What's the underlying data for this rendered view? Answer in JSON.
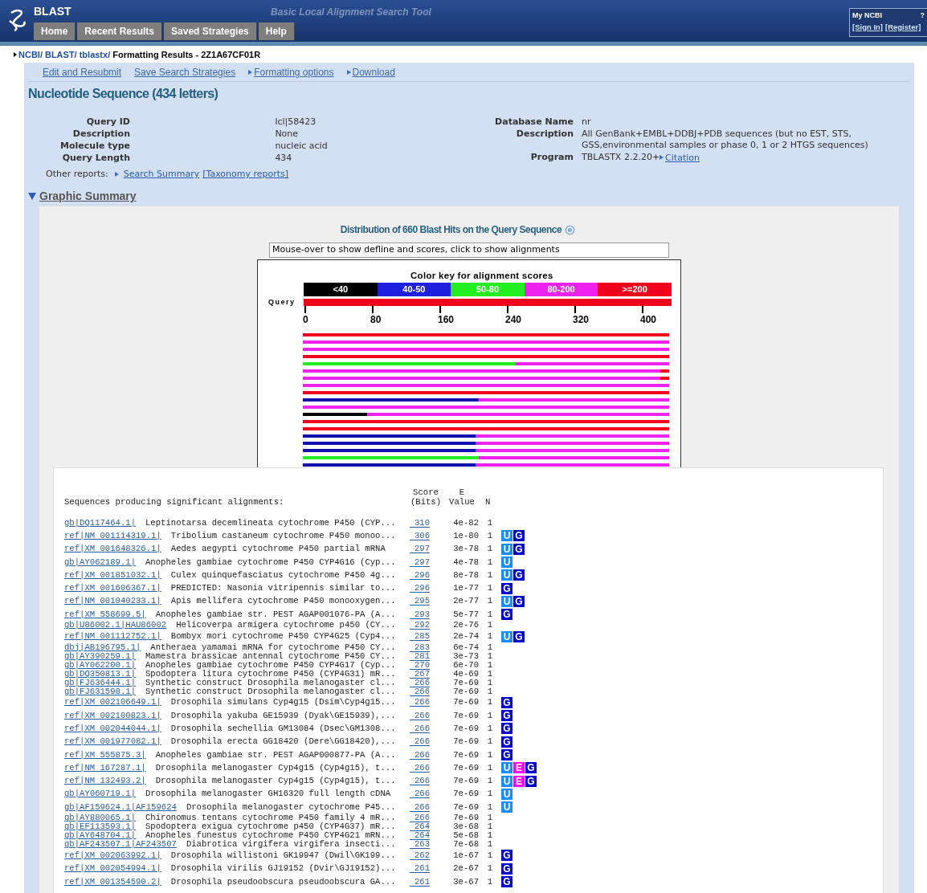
{
  "header": {
    "logo_text": "BLAST",
    "subtitle": "Basic Local Alignment Search Tool",
    "tabs": [
      {
        "label": "Home"
      },
      {
        "label": "Recent Results"
      },
      {
        "label": "Saved Strategies"
      },
      {
        "label": "Help"
      }
    ],
    "my_ncbi": {
      "title": "My NCBI",
      "help": "?",
      "links": [
        "[Sign In]",
        "[Register]"
      ]
    }
  },
  "breadcrumb": {
    "links": [
      "NCBI/",
      "BLAST/",
      "tblastx/"
    ],
    "current": "Formatting Results - 2Z1A67CF01R"
  },
  "toolbar": [
    {
      "label": "Edit and Resubmit",
      "kind": "plain"
    },
    {
      "label": "Save Search Strategies",
      "kind": "plain"
    },
    {
      "label": "Formatting options",
      "kind": "toggle"
    },
    {
      "label": "Download",
      "kind": "toggle"
    }
  ],
  "heading": "Nucleotide Sequence (434 letters)",
  "query_info": [
    {
      "label": "Query ID",
      "value": "lcl|58423"
    },
    {
      "label": "Description",
      "value": "None"
    },
    {
      "label": "Molecule type",
      "value": "nucleic acid"
    },
    {
      "label": "Query Length",
      "value": "434"
    }
  ],
  "database_info": [
    {
      "label": "Database Name",
      "value": "nr"
    },
    {
      "label": "Description",
      "value": "All GenBank+EMBL+DDBJ+PDB sequences (but no EST, STS, GSS,environmental samples or phase 0, 1 or 2 HTGS sequences)"
    },
    {
      "label": "Program",
      "value": "TBLASTX 2.2.20+",
      "link": "Citation"
    }
  ],
  "other_reports": {
    "label": "Other reports:",
    "links": [
      {
        "label": "Search Summary",
        "kind": "toggle"
      },
      {
        "label": "[Taxonomy reports]",
        "kind": "plain"
      }
    ]
  },
  "graphic_summary": {
    "title": "Graphic Summary",
    "expanded": true,
    "distribution_title": "Distribution of 660 Blast Hits on the Query Sequence",
    "info_field": {
      "value": "Mouse-over to show defline and scores, click to show alignments"
    },
    "color_key_title": "Color key for alignment scores",
    "color_key": [
      {
        "label": "<40",
        "color": "#000000"
      },
      {
        "label": "40-50",
        "color": "#1f1fe0"
      },
      {
        "label": "50-80",
        "color": "#22ee22"
      },
      {
        "label": "80-200",
        "color": "#ee22ee"
      },
      {
        "label": ">=200",
        "color": "#f0001c"
      }
    ],
    "query_label": "Query",
    "axis_ticks": [
      "0",
      "80",
      "160",
      "240",
      "320",
      "400"
    ]
  },
  "alignments": {
    "title": "Sequences producing significant alignments:",
    "columns": {
      "score": [
        "Score",
        "(Bits)"
      ],
      "evalue": [
        "E",
        "Value"
      ],
      "n": "N"
    },
    "rows": [
      {
        "accession": "gb|DQ117464.1|",
        "description": "Leptinotarsa decemlineata cytochrome P450 (CYP...",
        "score": "310",
        "evalue": "4e-82",
        "n": "1",
        "badges": []
      },
      {
        "accession": "ref|NM 001114319.1|",
        "description": "Tribolium castaneum cytochrome P450 monoo...",
        "score": "306",
        "evalue": "1e-80",
        "n": "1",
        "badges": [
          {
            "label": "U",
            "kind": "unigene"
          },
          {
            "label": "G",
            "kind": "gene"
          }
        ]
      },
      {
        "accession": "ref|XM 001648326.1|",
        "description": "Aedes aegypti cytochrome P450 partial mRNA",
        "score": "297",
        "evalue": "3e-78",
        "n": "1",
        "badges": [
          {
            "label": "U",
            "kind": "unigene"
          },
          {
            "label": "G",
            "kind": "gene"
          }
        ]
      },
      {
        "accession": "gb|AY062189.1|",
        "description": "Anopheles gambiae cytochrome P450 CYP4G16 (Cyp...",
        "score": "297",
        "evalue": "4e-78",
        "n": "1",
        "badges": [
          {
            "label": "U",
            "kind": "unigene"
          }
        ]
      },
      {
        "accession": "ref|XM 001851032.1|",
        "description": "Culex quinquefasciatus cytochrome P450 4g...",
        "score": "296",
        "evalue": "8e-78",
        "n": "1",
        "badges": [
          {
            "label": "U",
            "kind": "unigene"
          },
          {
            "label": "G",
            "kind": "gene"
          }
        ]
      },
      {
        "accession": "ref|XM 001606367.1|",
        "description": "PREDICTED: Nasonia vitripennis similar to...",
        "score": "296",
        "evalue": "1e-77",
        "n": "1",
        "badges": [
          {
            "label": "G",
            "kind": "gene"
          }
        ]
      },
      {
        "accession": "ref|NM 001040233.1|",
        "description": "Apis mellifera cytochrome P450 monooxygen...",
        "score": "295",
        "evalue": "2e-77",
        "n": "1",
        "badges": [
          {
            "label": "U",
            "kind": "unigene"
          },
          {
            "label": "G",
            "kind": "gene"
          }
        ]
      },
      {
        "accession": "ref|XM 558699.5|",
        "description": "Anopheles gambiae str. PEST AGAP001076-PA (A...",
        "score": "293",
        "evalue": "5e-77",
        "n": "1",
        "badges": [
          {
            "label": "G",
            "kind": "gene"
          }
        ]
      },
      {
        "accession": "gb|U86002.1|HAU86002",
        "description": "Helicoverpa armigera cytochrome p450 (CY...",
        "score": "292",
        "evalue": "2e-76",
        "n": "1",
        "badges": []
      },
      {
        "accession": "ref|NM 001112752.1|",
        "description": "Bombyx mori cytochrome P450 CYP4G25 (Cyp4...",
        "score": "285",
        "evalue": "2e-74",
        "n": "1",
        "badges": [
          {
            "label": "U",
            "kind": "unigene"
          },
          {
            "label": "G",
            "kind": "gene"
          }
        ]
      },
      {
        "accession": "dbj|AB196795.1|",
        "description": "Antheraea yamamai mRNA for cytochrome P450 CY...",
        "score": "283",
        "evalue": "6e-74",
        "n": "1",
        "badges": []
      },
      {
        "accession": "gb|AY390259.1|",
        "description": "Mamestra brassicae antennal cytochrome P450 CY...",
        "score": "281",
        "evalue": "3e-73",
        "n": "1",
        "badges": []
      },
      {
        "accession": "gb|AY062200.1|",
        "description": "Anopheles gambiae cytochrome P450 CYP4G17 (Cyp...",
        "score": "270",
        "evalue": "6e-70",
        "n": "1",
        "badges": []
      },
      {
        "accession": "gb|DQ350813.1|",
        "description": "Spodoptera litura cytochrome P450 (CYP4G31) mR...",
        "score": "267",
        "evalue": "4e-69",
        "n": "1",
        "badges": []
      },
      {
        "accession": "gb|FJ636444.1|",
        "description": "Synthetic construct Drosophila melanogaster cl...",
        "score": "266",
        "evalue": "7e-69",
        "n": "1",
        "badges": []
      },
      {
        "accession": "gb|FJ631598.1|",
        "description": "Synthetic construct Drosophila melanogaster cl...",
        "score": "266",
        "evalue": "7e-69",
        "n": "1",
        "badges": []
      },
      {
        "accession": "ref|XM 002106649.1|",
        "description": "Drosophila simulans Cyp4g15 (Dsim\\Cyp4g15...",
        "score": "266",
        "evalue": "7e-69",
        "n": "1",
        "badges": [
          {
            "label": "G",
            "kind": "gene"
          }
        ]
      },
      {
        "accession": "ref|XM 002100823.1|",
        "description": "Drosophila yakuba GE15939 (Dyak\\GE15939),...",
        "score": "266",
        "evalue": "7e-69",
        "n": "1",
        "badges": [
          {
            "label": "G",
            "kind": "gene"
          }
        ]
      },
      {
        "accession": "ref|XM 002044044.1|",
        "description": "Drosophila sechellia GM13084 (Dsec\\GM1308...",
        "score": "266",
        "evalue": "7e-69",
        "n": "1",
        "badges": [
          {
            "label": "G",
            "kind": "gene"
          }
        ]
      },
      {
        "accession": "ref|XM 001977082.1|",
        "description": "Drosophila erecta GG18420 (Dere\\GG18420),...",
        "score": "266",
        "evalue": "7e-69",
        "n": "1",
        "badges": [
          {
            "label": "G",
            "kind": "gene"
          }
        ]
      },
      {
        "accession": "ref|XM 555875.3|",
        "description": "Anopheles gambiae str. PEST AGAP000877-PA (A...",
        "score": "266",
        "evalue": "7e-69",
        "n": "1",
        "badges": [
          {
            "label": "G",
            "kind": "gene"
          }
        ]
      },
      {
        "accession": "ref|NM 167287.1|",
        "description": "Drosophila melanogaster Cyp4g15 (Cyp4g15), t...",
        "score": "266",
        "evalue": "7e-69",
        "n": "1",
        "badges": [
          {
            "label": "U",
            "kind": "unigene"
          },
          {
            "label": "E",
            "kind": "geo"
          },
          {
            "label": "G",
            "kind": "gene"
          }
        ]
      },
      {
        "accession": "ref|NM 132493.2|",
        "description": "Drosophila melanogaster Cyp4g15 (Cyp4g15), t...",
        "score": "266",
        "evalue": "7e-69",
        "n": "1",
        "badges": [
          {
            "label": "U",
            "kind": "unigene"
          },
          {
            "label": "E",
            "kind": "geo"
          },
          {
            "label": "G",
            "kind": "gene"
          }
        ]
      },
      {
        "accession": "gb|AY060719.1|",
        "description": "Drosophila melanogaster GH16320 full length cDNA",
        "score": "266",
        "evalue": "7e-69",
        "n": "1",
        "badges": [
          {
            "label": "U",
            "kind": "unigene"
          }
        ]
      },
      {
        "accession": "gb|AF159624.1|AF159624",
        "description": "Drosophila melanogaster cytochrome P45...",
        "score": "266",
        "evalue": "7e-69",
        "n": "1",
        "badges": [
          {
            "label": "U",
            "kind": "unigene"
          }
        ]
      },
      {
        "accession": "gb|AY880065.1|",
        "description": "Chironomus tentans cytochrome P450 family 4 mR...",
        "score": "266",
        "evalue": "7e-69",
        "n": "1",
        "badges": []
      },
      {
        "accession": "gb|EF113593.1|",
        "description": "Spodoptera exigua cytochrome p450 (CYP4G37) mR...",
        "score": "264",
        "evalue": "3e-68",
        "n": "1",
        "badges": []
      },
      {
        "accession": "gb|AY648704.1|",
        "description": "Anopheles funestus cytochrome P450 CYP4G21 mRN...",
        "score": "264",
        "evalue": "5e-68",
        "n": "1",
        "badges": []
      },
      {
        "accession": "gb|AF243507.1|AF243507",
        "description": "Diabrotica virgifera virgifera insecti...",
        "score": "263",
        "evalue": "7e-68",
        "n": "1",
        "badges": []
      },
      {
        "accession": "ref|XM 002063992.1|",
        "description": "Drosophila willistoni GK19947 (Dwil\\GK199...",
        "score": "262",
        "evalue": "1e-67",
        "n": "1",
        "badges": [
          {
            "label": "G",
            "kind": "gene"
          }
        ]
      },
      {
        "accession": "ref|XM 002054994.1|",
        "description": "Drosophila virilis GJ19152 (Dvir\\GJ19152)...",
        "score": "261",
        "evalue": "2e-67",
        "n": "1",
        "badges": [
          {
            "label": "G",
            "kind": "gene"
          }
        ]
      },
      {
        "accession": "ref|XM 001354590.2|",
        "description": "Drosophila pseudoobscura pseudoobscura GA...",
        "score": "261",
        "evalue": "3e-67",
        "n": "1",
        "badges": [
          {
            "label": "G",
            "kind": "gene"
          }
        ]
      }
    ]
  }
}
